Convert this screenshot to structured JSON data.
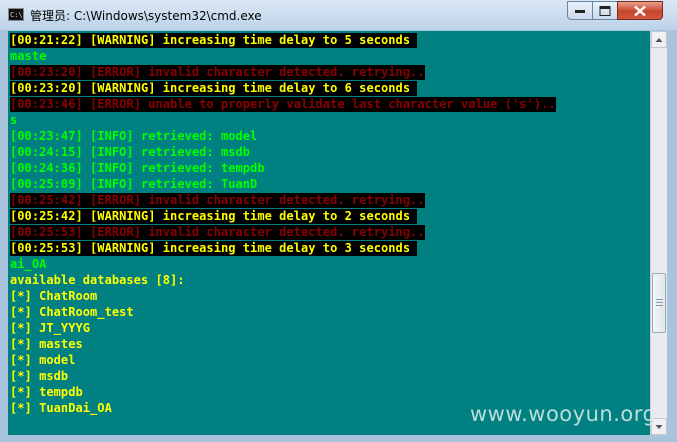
{
  "window": {
    "title": "管理员: C:\\Windows\\system32\\cmd.exe",
    "icon_label": "C:\\"
  },
  "colors": {
    "console_bg": "#008080",
    "yellow": "#ffff00",
    "red": "#8b0000",
    "green": "#00ff00",
    "black_highlight": "#000000"
  },
  "console_lines": [
    {
      "text": "[00:21:22] [WARNING] increasing time delay to 5 seconds ",
      "color": "#ffff00",
      "highlight": true
    },
    {
      "text": "maste",
      "color": "#00ff00",
      "highlight": false
    },
    {
      "text": "[00:23:20] [ERROR] invalid character detected. retrying..",
      "color": "#8b0000",
      "highlight": true
    },
    {
      "text": "[00:23:20] [WARNING] increasing time delay to 6 seconds ",
      "color": "#ffff00",
      "highlight": true
    },
    {
      "text": "[00:23:46] [ERROR] unable to properly validate last character value ('s')..",
      "color": "#8b0000",
      "highlight": true
    },
    {
      "text": "s",
      "color": "#00ff00",
      "highlight": false
    },
    {
      "text": "[00:23:47] [INFO] retrieved: model",
      "color": "#00ff00",
      "highlight": false
    },
    {
      "text": "[00:24:15] [INFO] retrieved: msdb",
      "color": "#00ff00",
      "highlight": false
    },
    {
      "text": "[00:24:36] [INFO] retrieved: tempdb",
      "color": "#00ff00",
      "highlight": false
    },
    {
      "text": "[00:25:09] [INFO] retrieved: TuanD",
      "color": "#00ff00",
      "highlight": false
    },
    {
      "text": "[00:25:42] [ERROR] invalid character detected. retrying..",
      "color": "#8b0000",
      "highlight": true
    },
    {
      "text": "[00:25:42] [WARNING] increasing time delay to 2 seconds ",
      "color": "#ffff00",
      "highlight": true
    },
    {
      "text": "[00:25:53] [ERROR] invalid character detected. retrying..",
      "color": "#8b0000",
      "highlight": true
    },
    {
      "text": "[00:25:53] [WARNING] increasing time delay to 3 seconds ",
      "color": "#ffff00",
      "highlight": true
    },
    {
      "text": "ai_OA",
      "color": "#00ff00",
      "highlight": false
    },
    {
      "text": "available databases [8]:",
      "color": "#ffff00",
      "highlight": false
    },
    {
      "text": "[*] ChatRoom",
      "color": "#ffff00",
      "highlight": false
    },
    {
      "text": "[*] ChatRoom_test",
      "color": "#ffff00",
      "highlight": false
    },
    {
      "text": "[*] JT_YYYG",
      "color": "#ffff00",
      "highlight": false
    },
    {
      "text": "[*] mastes",
      "color": "#ffff00",
      "highlight": false
    },
    {
      "text": "[*] model",
      "color": "#ffff00",
      "highlight": false
    },
    {
      "text": "[*] msdb",
      "color": "#ffff00",
      "highlight": false
    },
    {
      "text": "[*] tempdb",
      "color": "#ffff00",
      "highlight": false
    },
    {
      "text": "[*] TuanDai_OA",
      "color": "#ffff00",
      "highlight": false
    }
  ],
  "watermark": "www.wooyun.org"
}
